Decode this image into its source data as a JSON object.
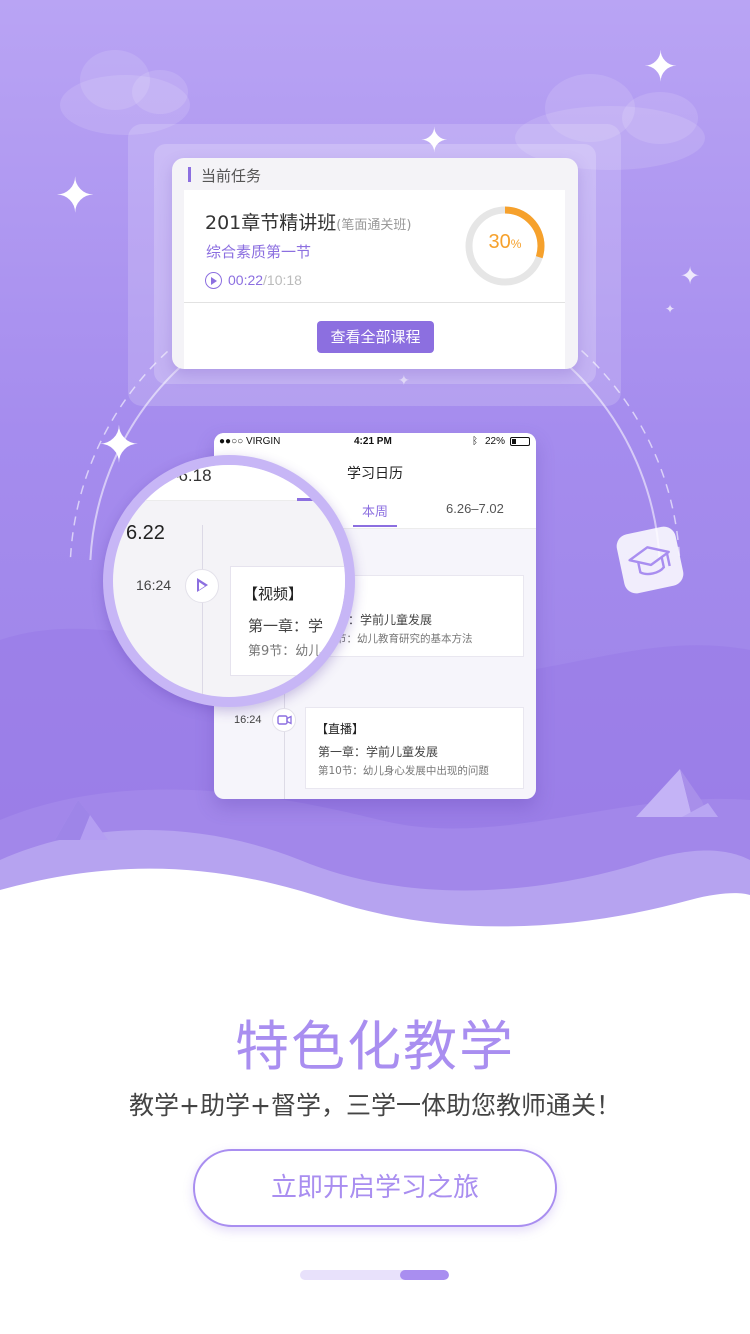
{
  "task_card": {
    "header": "当前任务",
    "course_name": "201章节精讲班",
    "course_note": "(笔面通关班)",
    "lesson": "综合素质第一节",
    "elapsed": "00:22",
    "total": "/10:18",
    "progress_value": "30",
    "progress_unit": "%",
    "progress_fraction": 0.3,
    "button_label": "查看全部课程"
  },
  "phone": {
    "carrier": "●●○○ VIRGIN",
    "clock": "4:21 PM",
    "battery": "22%",
    "title": "学习日历",
    "tab_current": "本周",
    "tab_next": "6.26–7.02",
    "events": [
      {
        "time": "16:24",
        "tag": "【视频】",
        "chapter": "第一章：学前儿童发展",
        "section": "第9节：幼儿教育研究的基本方法",
        "visible_chapter": "章：学前儿童发展",
        "visible_section": "节：幼儿教育研究的基本方法"
      },
      {
        "time": "16:24",
        "tag": "【直播】",
        "chapter": "第一章：学前儿童发展",
        "section": "第10节：幼儿身心发展中出现的问题"
      }
    ]
  },
  "magnifier": {
    "range": "–6.18",
    "date": "6.22",
    "time": "16:24",
    "tag": "【视频】",
    "chapter": "第一章：学",
    "section": "第9节：幼儿"
  },
  "footer": {
    "headline": "特色化教学",
    "subline": "教学+助学+督学，三学一体助您教师通关！",
    "start_button": "立即开启学习之旅",
    "page_count": 3,
    "active_page": 3
  },
  "colors": {
    "accent": "#8c6fe0",
    "headline": "#a98ef0",
    "progress": "#f6a12c"
  }
}
